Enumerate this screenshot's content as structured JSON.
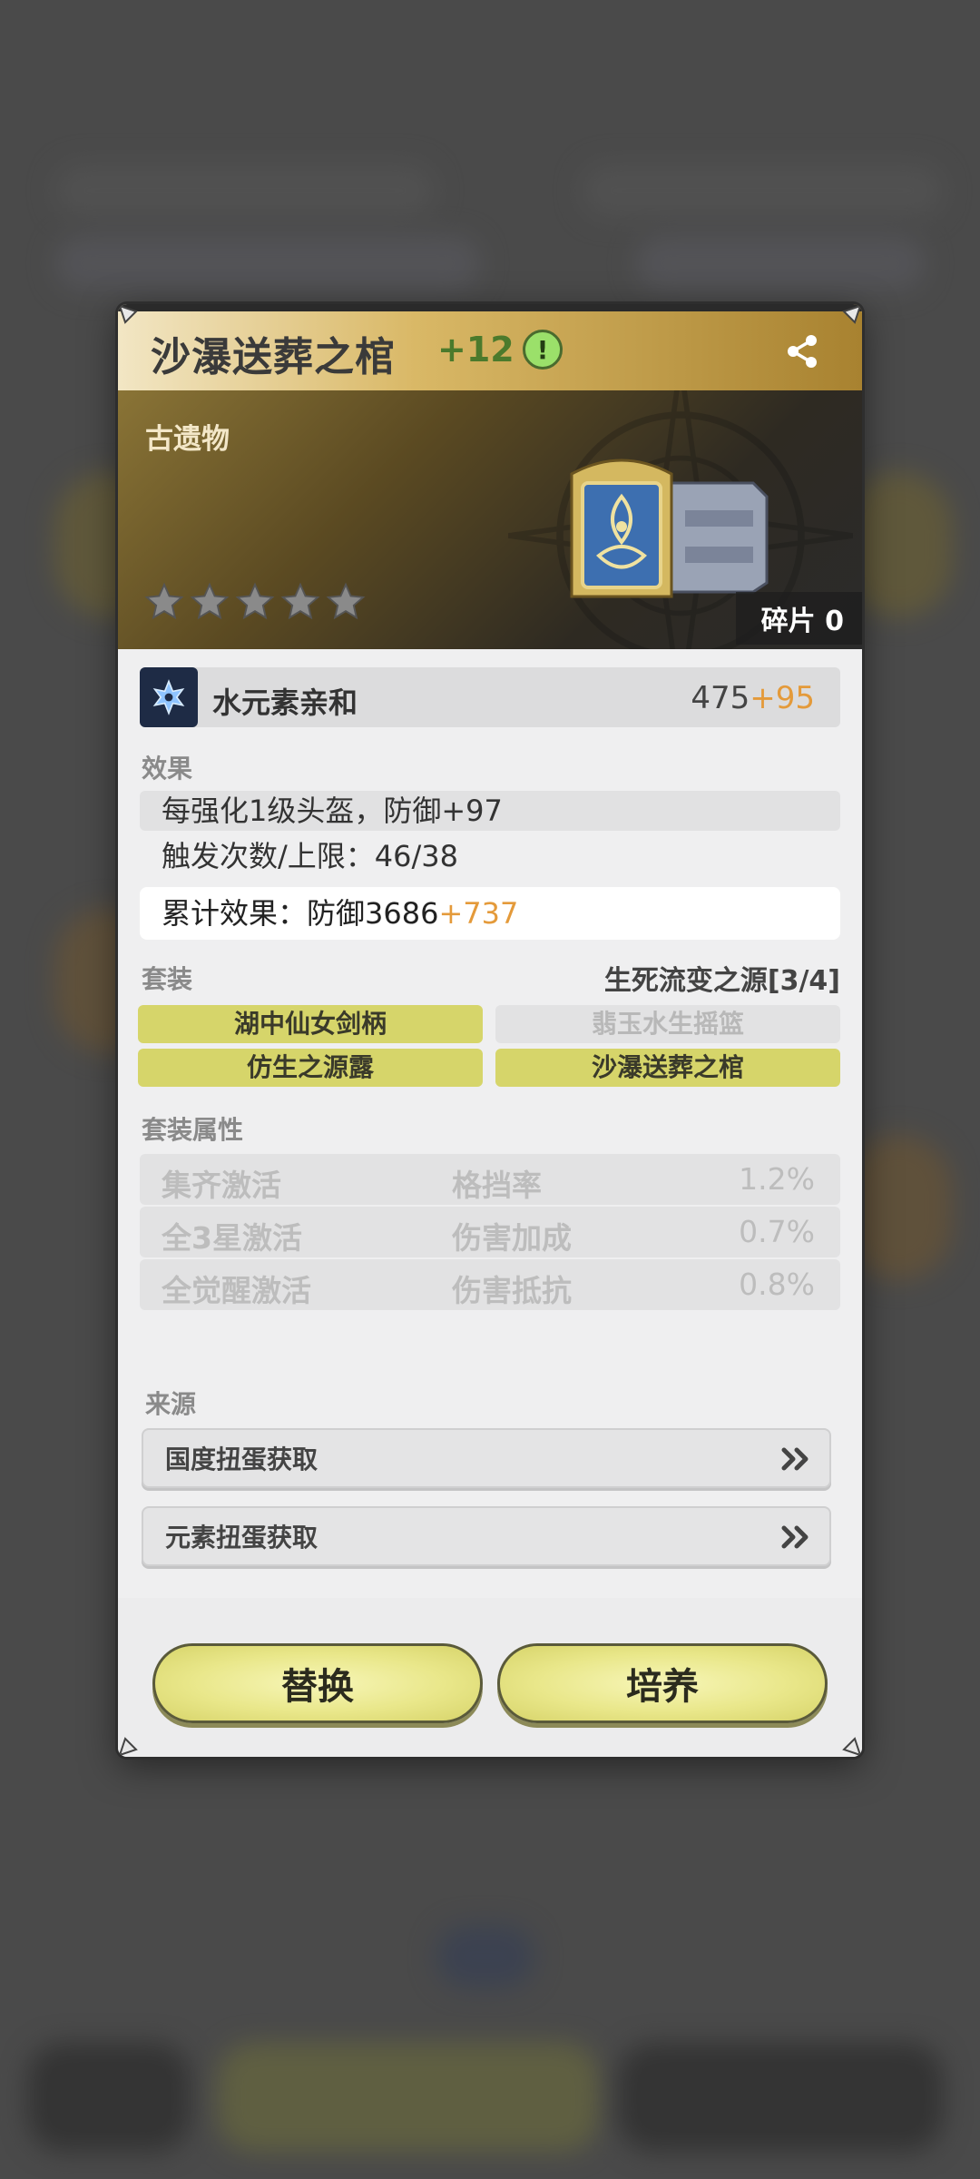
{
  "header": {
    "title": "沙瀑送葬之棺",
    "level": "+12",
    "info_icon": "!"
  },
  "hero": {
    "category": "古遗物",
    "stars_filled": 0,
    "stars_total": 5,
    "fragments": "碎片 0"
  },
  "element": {
    "name": "水元素亲和",
    "value": "475",
    "bonus": "+95",
    "icon": "hydro-icon"
  },
  "effect": {
    "label": "效果",
    "line1": "每强化1级头盔，防御+97",
    "line2": "触发次数/上限：46/38",
    "cumulative_prefix": "累计效果：防御3686",
    "cumulative_bonus": "+737"
  },
  "set": {
    "label": "套装",
    "name": "生死流变之源[3/4]",
    "pieces": [
      {
        "name": "湖中仙女剑柄",
        "active": true
      },
      {
        "name": "翡玉水生摇篮",
        "active": false
      },
      {
        "name": "仿生之源露",
        "active": true
      },
      {
        "name": "沙瀑送葬之棺",
        "active": true
      }
    ]
  },
  "set_attributes": {
    "label": "套装属性",
    "rows": [
      {
        "condition": "集齐激活",
        "stat": "格挡率",
        "value": "1.2%"
      },
      {
        "condition": "全3星激活",
        "stat": "伤害加成",
        "value": "0.7%"
      },
      {
        "condition": "全觉醒激活",
        "stat": "伤害抵抗",
        "value": "0.8%"
      }
    ]
  },
  "source": {
    "label": "来源",
    "items": [
      "国度扭蛋获取",
      "元素扭蛋获取"
    ]
  },
  "actions": {
    "replace": "替换",
    "cultivate": "培养"
  }
}
